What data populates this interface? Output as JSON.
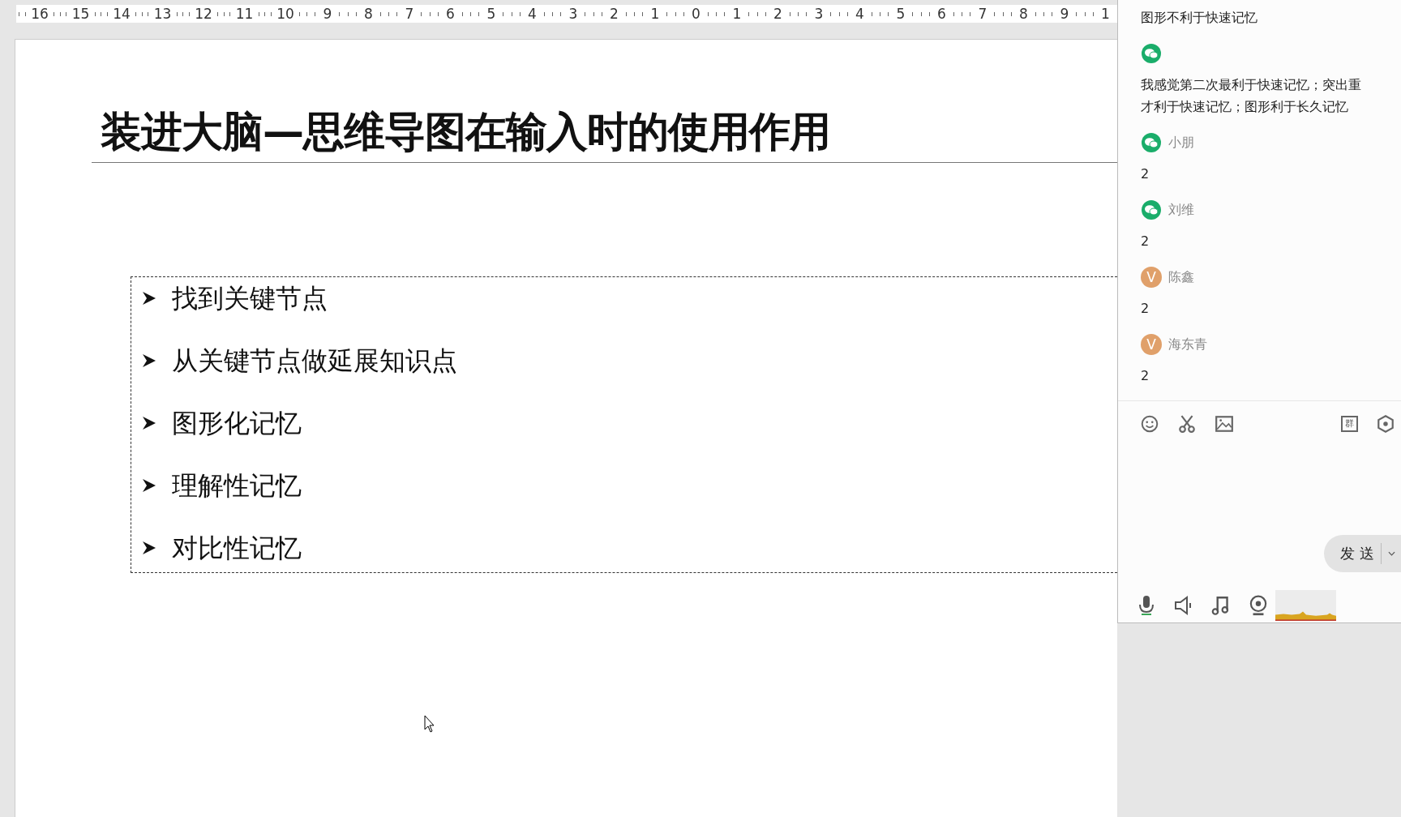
{
  "ruler": {
    "numbers": [
      "16",
      "15",
      "14",
      "13",
      "12",
      "11",
      "10",
      "9",
      "8",
      "7",
      "6",
      "5",
      "4",
      "3",
      "2",
      "1",
      "0",
      "1",
      "2",
      "3",
      "4",
      "5",
      "6",
      "7",
      "8",
      "9",
      "1"
    ]
  },
  "slide": {
    "title": "装进大脑—思维导图在输入时的使用作用",
    "bullets": [
      "找到关键节点",
      "从关键节点做延展知识点",
      "图形化记忆",
      "理解性记忆",
      "对比性记忆"
    ]
  },
  "chat": {
    "messages": [
      {
        "kind": "plain",
        "lines": [
          "图形不利于快速记忆"
        ]
      },
      {
        "kind": "wechat",
        "lines": [
          "我感觉第二次最利于快速记忆；突出重",
          "才利于快速记忆；图形利于长久记忆"
        ]
      },
      {
        "kind": "wechat",
        "name": "小朋",
        "lines": [
          "2"
        ]
      },
      {
        "kind": "wechat",
        "name": "刘维",
        "lines": [
          "2"
        ]
      },
      {
        "kind": "letter",
        "letter": "V",
        "name": "陈鑫",
        "lines": [
          "2"
        ]
      },
      {
        "kind": "letter",
        "letter": "V",
        "name": "海东青",
        "lines": [
          "2"
        ]
      }
    ],
    "group_icon_label": "群",
    "send_button": "发 送"
  }
}
